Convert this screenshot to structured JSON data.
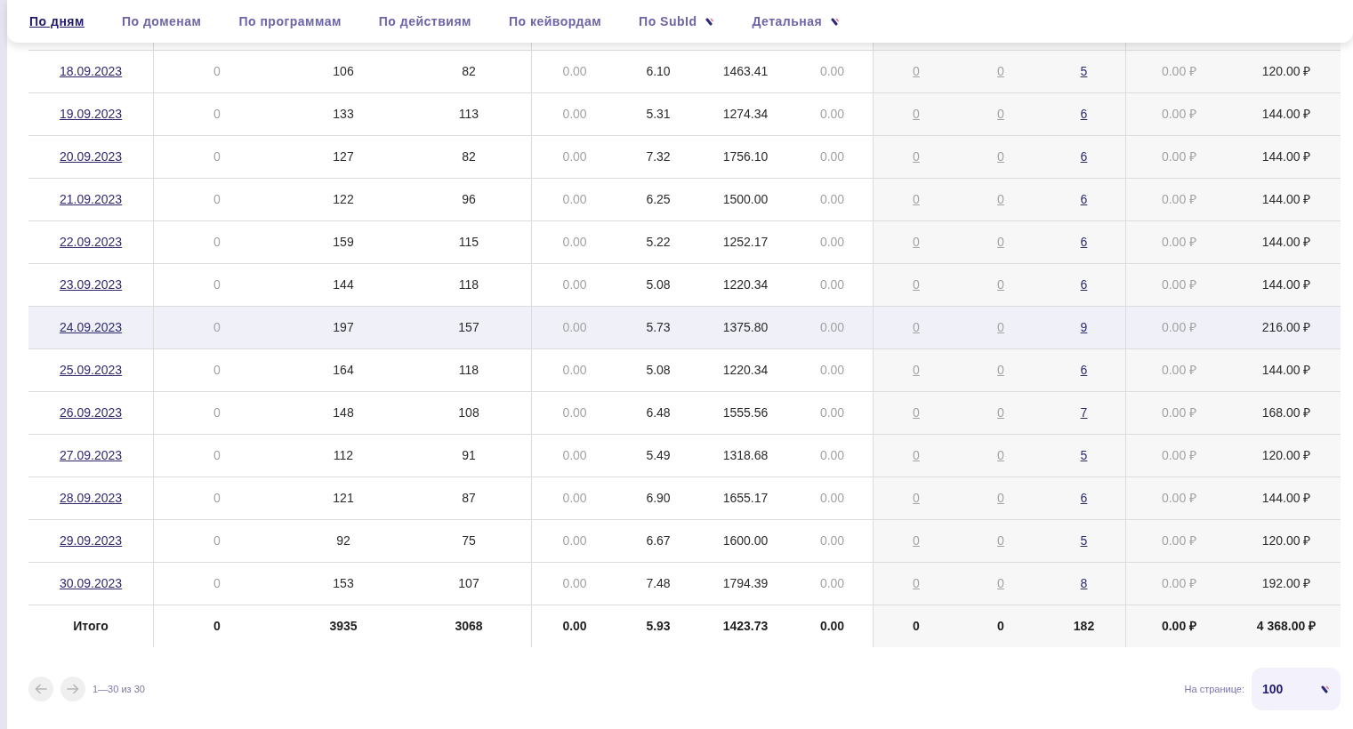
{
  "tabs": [
    {
      "label": "По дням",
      "selected": true,
      "dropdown": false
    },
    {
      "label": "По доменам",
      "selected": false,
      "dropdown": false
    },
    {
      "label": "По программам",
      "selected": false,
      "dropdown": false
    },
    {
      "label": "По действиям",
      "selected": false,
      "dropdown": false
    },
    {
      "label": "По кейвордам",
      "selected": false,
      "dropdown": false
    },
    {
      "label": "По SubId",
      "selected": false,
      "dropdown": true
    },
    {
      "label": "Детальная",
      "selected": false,
      "dropdown": true
    }
  ],
  "table": {
    "columns": [
      {
        "kind": "date"
      },
      {
        "kind": "muted"
      },
      {
        "kind": "plain"
      },
      {
        "kind": "plain"
      },
      {
        "kind": "muted"
      },
      {
        "kind": "plain"
      },
      {
        "kind": "plain"
      },
      {
        "kind": "muted"
      },
      {
        "kind": "muted-link"
      },
      {
        "kind": "muted-link"
      },
      {
        "kind": "link"
      },
      {
        "kind": "muted"
      },
      {
        "kind": "plain"
      }
    ],
    "rows": [
      {
        "selected": false,
        "cells": [
          "18.09.2023",
          "0",
          "106",
          "82",
          "0.00",
          "6.10",
          "1463.41",
          "0.00",
          "0",
          "0",
          "5",
          "0.00 ₽",
          "120.00 ₽"
        ]
      },
      {
        "selected": false,
        "cells": [
          "19.09.2023",
          "0",
          "133",
          "113",
          "0.00",
          "5.31",
          "1274.34",
          "0.00",
          "0",
          "0",
          "6",
          "0.00 ₽",
          "144.00 ₽"
        ]
      },
      {
        "selected": false,
        "cells": [
          "20.09.2023",
          "0",
          "127",
          "82",
          "0.00",
          "7.32",
          "1756.10",
          "0.00",
          "0",
          "0",
          "6",
          "0.00 ₽",
          "144.00 ₽"
        ]
      },
      {
        "selected": false,
        "cells": [
          "21.09.2023",
          "0",
          "122",
          "96",
          "0.00",
          "6.25",
          "1500.00",
          "0.00",
          "0",
          "0",
          "6",
          "0.00 ₽",
          "144.00 ₽"
        ]
      },
      {
        "selected": false,
        "cells": [
          "22.09.2023",
          "0",
          "159",
          "115",
          "0.00",
          "5.22",
          "1252.17",
          "0.00",
          "0",
          "0",
          "6",
          "0.00 ₽",
          "144.00 ₽"
        ]
      },
      {
        "selected": false,
        "cells": [
          "23.09.2023",
          "0",
          "144",
          "118",
          "0.00",
          "5.08",
          "1220.34",
          "0.00",
          "0",
          "0",
          "6",
          "0.00 ₽",
          "144.00 ₽"
        ]
      },
      {
        "selected": true,
        "cells": [
          "24.09.2023",
          "0",
          "197",
          "157",
          "0.00",
          "5.73",
          "1375.80",
          "0.00",
          "0",
          "0",
          "9",
          "0.00 ₽",
          "216.00 ₽"
        ]
      },
      {
        "selected": false,
        "cells": [
          "25.09.2023",
          "0",
          "164",
          "118",
          "0.00",
          "5.08",
          "1220.34",
          "0.00",
          "0",
          "0",
          "6",
          "0.00 ₽",
          "144.00 ₽"
        ]
      },
      {
        "selected": false,
        "cells": [
          "26.09.2023",
          "0",
          "148",
          "108",
          "0.00",
          "6.48",
          "1555.56",
          "0.00",
          "0",
          "0",
          "7",
          "0.00 ₽",
          "168.00 ₽"
        ]
      },
      {
        "selected": false,
        "cells": [
          "27.09.2023",
          "0",
          "112",
          "91",
          "0.00",
          "5.49",
          "1318.68",
          "0.00",
          "0",
          "0",
          "5",
          "0.00 ₽",
          "120.00 ₽"
        ]
      },
      {
        "selected": false,
        "cells": [
          "28.09.2023",
          "0",
          "121",
          "87",
          "0.00",
          "6.90",
          "1655.17",
          "0.00",
          "0",
          "0",
          "6",
          "0.00 ₽",
          "144.00 ₽"
        ]
      },
      {
        "selected": false,
        "cells": [
          "29.09.2023",
          "0",
          "92",
          "75",
          "0.00",
          "6.67",
          "1600.00",
          "0.00",
          "0",
          "0",
          "5",
          "0.00 ₽",
          "120.00 ₽"
        ]
      },
      {
        "selected": false,
        "cells": [
          "30.09.2023",
          "0",
          "153",
          "107",
          "0.00",
          "7.48",
          "1794.39",
          "0.00",
          "0",
          "0",
          "8",
          "0.00 ₽",
          "192.00 ₽"
        ]
      }
    ],
    "totals": [
      "Итого",
      "0",
      "3935",
      "3068",
      "0.00",
      "5.93",
      "1423.73",
      "0.00",
      "0",
      "0",
      "182",
      "0.00 ₽",
      "4 368.00 ₽"
    ]
  },
  "pagination": {
    "prev": {
      "disabled": true
    },
    "next": {
      "disabled": true
    },
    "range": "1—30 из 30",
    "per_page_label": "На странице:",
    "per_page_value": "100"
  }
}
